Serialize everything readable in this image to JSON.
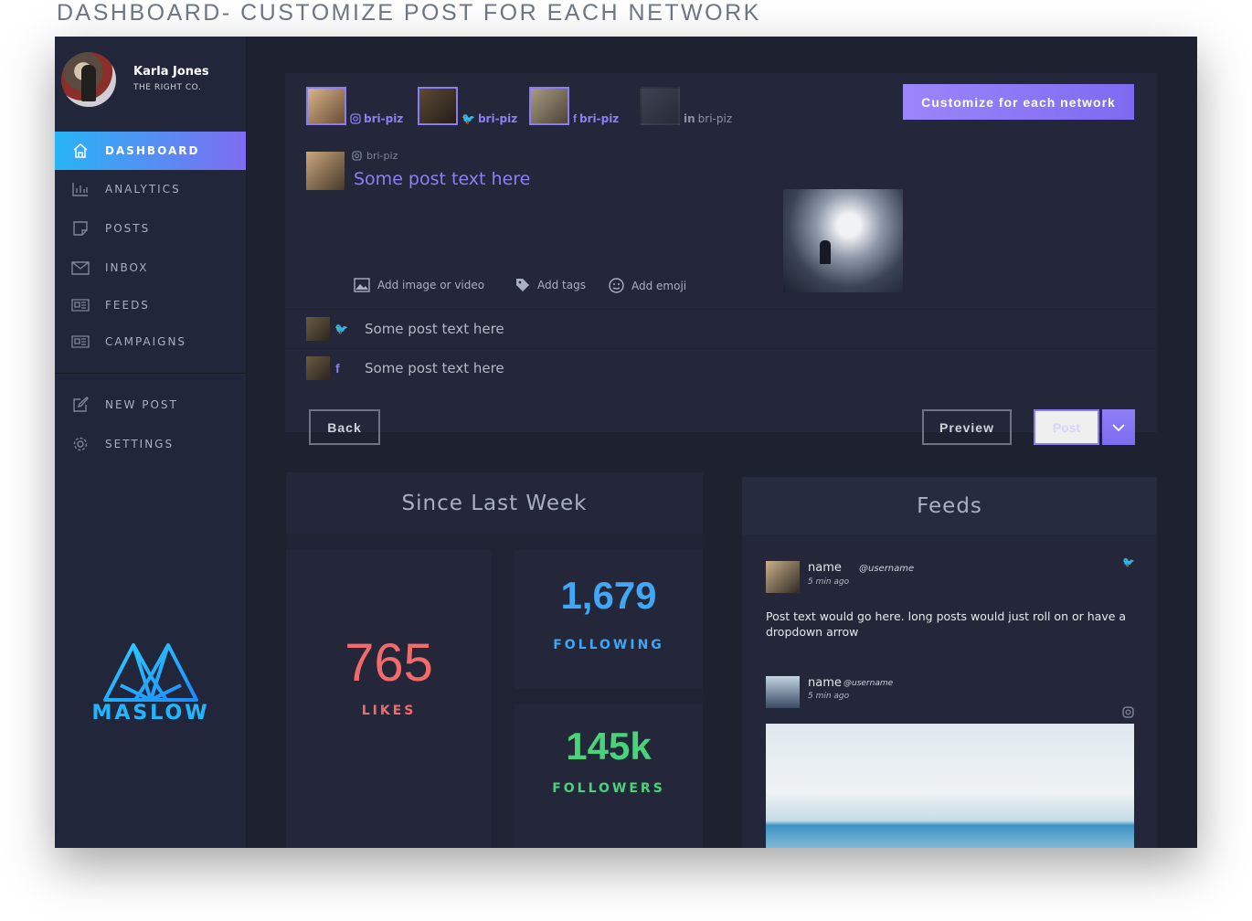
{
  "page_heading": "DASHBOARD- CUSTOMIZE POST FOR EACH NETWORK",
  "profile": {
    "name": "Karla Jones",
    "company": "THE RIGHT CO."
  },
  "nav": {
    "dashboard": "DASHBOARD",
    "analytics": "ANALYTICS",
    "posts": "POSTS",
    "inbox": "INBOX",
    "feeds": "FEEDS",
    "campaigns": "CAMPAIGNS",
    "new_post": "NEW POST",
    "settings": "SETTINGS"
  },
  "logo": {
    "text": "MASLOW"
  },
  "composer": {
    "accounts": [
      {
        "network": "instagram",
        "handle": "bri-piz",
        "selected": true
      },
      {
        "network": "twitter",
        "handle": "bri-piz",
        "selected": true
      },
      {
        "network": "facebook",
        "handle": "bri-piz",
        "selected": true
      },
      {
        "network": "linkedin",
        "handle": "bri-piz",
        "selected": false
      }
    ],
    "customize_button": "Customize for each network",
    "main_post": {
      "network": "instagram",
      "handle": "bri-piz",
      "text": "Some post text here"
    },
    "tools": {
      "add_media": "Add image or video",
      "add_tags": "Add tags",
      "add_emoji": "Add emoji"
    },
    "network_posts": [
      {
        "network": "twitter",
        "text": "Some post text here"
      },
      {
        "network": "facebook",
        "text": "Some post text here"
      }
    ],
    "back_button": "Back",
    "preview_button": "Preview",
    "post_button": "Post"
  },
  "stats": {
    "title": "Since Last Week",
    "likes": {
      "value": "765",
      "label": "LIKES",
      "color": "#f26b6b"
    },
    "following": {
      "value": "1,679",
      "label": "FOLLOWING",
      "color": "#3fa7f5"
    },
    "followers": {
      "value": "145k",
      "label": "FOLLOWERS",
      "color": "#49d37a"
    }
  },
  "feeds": {
    "title": "Feeds",
    "items": [
      {
        "name": "name",
        "username": "@username",
        "time": "5 min ago",
        "network": "twitter",
        "text": "Post text would go here. long posts would just roll on or have a dropdown arrow"
      },
      {
        "name": "name",
        "username": "@username",
        "time": "5 min ago",
        "network": "instagram"
      }
    ]
  },
  "colors": {
    "accent": "#8a7cf5",
    "active_nav_start": "#27b4f5",
    "active_nav_end": "#7f6cf2",
    "logo": "#1fb6ff"
  }
}
